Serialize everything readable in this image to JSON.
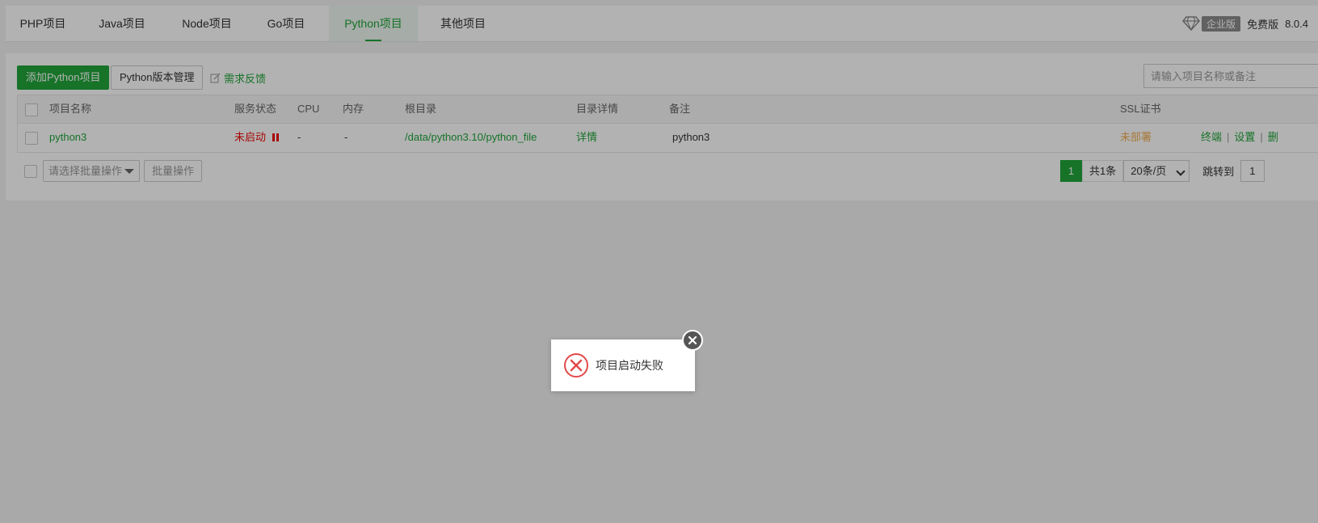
{
  "tabs": [
    {
      "label": "PHP项目",
      "active": false
    },
    {
      "label": "Java项目",
      "active": false
    },
    {
      "label": "Node项目",
      "active": false
    },
    {
      "label": "Go项目",
      "active": false
    },
    {
      "label": "Python项目",
      "active": true
    },
    {
      "label": "其他项目",
      "active": false
    }
  ],
  "version": {
    "enterprise_badge": "企业版",
    "edition": "免费版",
    "number": "8.0.4"
  },
  "toolbar": {
    "add_label": "添加Python项目",
    "manage_label": "Python版本管理",
    "feedback_label": "需求反馈",
    "search_placeholder": "请输入项目名称或备注"
  },
  "table": {
    "headers": {
      "name": "项目名称",
      "status": "服务状态",
      "cpu": "CPU",
      "memory": "内存",
      "root": "根目录",
      "detail": "目录详情",
      "remark": "备注",
      "ssl": "SSL证书"
    },
    "rows": [
      {
        "name": "python3",
        "status": "未启动",
        "cpu": "-",
        "memory": "-",
        "root": "/data/python3.10/python_file",
        "detail": "详情",
        "remark": "python3",
        "ssl": "未部署",
        "actions": [
          "终端",
          "设置",
          "删"
        ]
      }
    ]
  },
  "footer": {
    "batch_select_placeholder": "请选择批量操作",
    "batch_button": "批量操作",
    "pager": {
      "current_page": "1",
      "total": "共1条",
      "page_size": "20条/页",
      "jump_label": "跳转到",
      "jump_value": "1"
    }
  },
  "toast": {
    "message": "项目启动失败"
  },
  "colors": {
    "brand_green": "#20a53a",
    "error_red": "#ef0808",
    "warning_orange": "#f0ad4e",
    "toast_error_icon": "#e24a4a"
  }
}
